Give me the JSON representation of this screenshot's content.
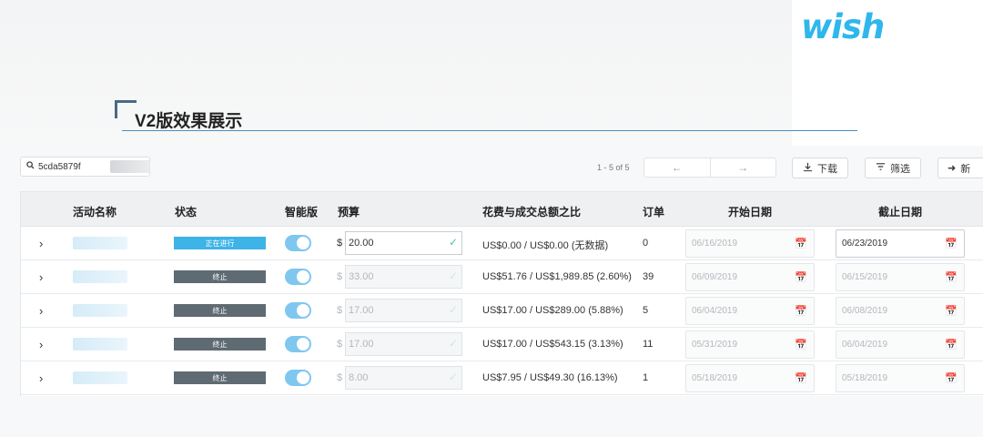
{
  "brand": {
    "logo": "wish"
  },
  "heading": "V2版效果展示",
  "toolbar": {
    "search_value": "5cda5879f",
    "pagination_text": "1 - 5 of 5",
    "download_label": "下载",
    "filter_label": "筛选",
    "more_label": "新"
  },
  "table": {
    "columns": [
      "活动名称",
      "状态",
      "智能版",
      "预算",
      "花费与成交总额之比",
      "订单",
      "开始日期",
      "截止日期"
    ],
    "rows": [
      {
        "status": "正在进行",
        "status_color": "#3db3e8",
        "currency": "$",
        "budget": "20.00",
        "spend_ratio": "US$0.00 / US$0.00 (无数据)",
        "orders": "0",
        "start_date": "06/16/2019",
        "end_date": "06/23/2019"
      },
      {
        "status": "终止",
        "status_color": "#5f6b73",
        "currency": "$",
        "budget": "33.00",
        "spend_ratio": "US$51.76 / US$1,989.85 (2.60%)",
        "orders": "39",
        "start_date": "06/09/2019",
        "end_date": "06/15/2019"
      },
      {
        "status": "终止",
        "status_color": "#5f6b73",
        "currency": "$",
        "budget": "17.00",
        "spend_ratio": "US$17.00 / US$289.00 (5.88%)",
        "orders": "5",
        "start_date": "06/04/2019",
        "end_date": "06/08/2019"
      },
      {
        "status": "终止",
        "status_color": "#5f6b73",
        "currency": "$",
        "budget": "17.00",
        "spend_ratio": "US$17.00 / US$543.15 (3.13%)",
        "orders": "11",
        "start_date": "05/31/2019",
        "end_date": "06/04/2019"
      },
      {
        "status": "终止",
        "status_color": "#5f6b73",
        "currency": "$",
        "budget": "8.00",
        "spend_ratio": "US$7.95 / US$49.30 (16.13%)",
        "orders": "1",
        "start_date": "05/18/2019",
        "end_date": "05/18/2019"
      }
    ]
  },
  "colors": {
    "accent": "#2fb7ec",
    "toggle_on": "#7fc7ef",
    "check": "#4cc79a",
    "heading_rule": "#4a8fbf"
  }
}
